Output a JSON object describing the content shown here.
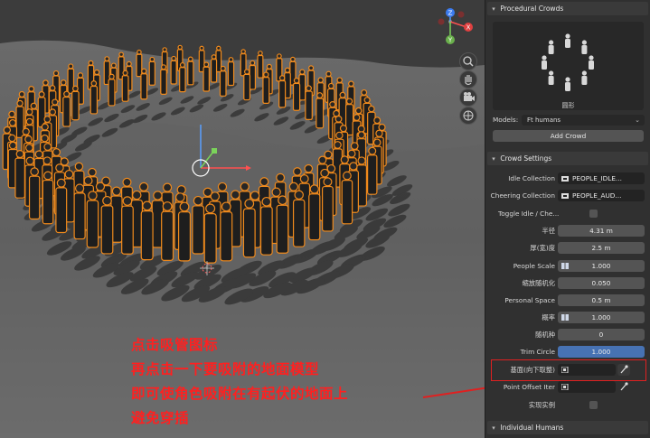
{
  "panel": {
    "procedural_crowds": {
      "title": "Procedural Crowds",
      "preview_label": "圆形",
      "models_label": "Models:",
      "models_value": "Ft humans",
      "add_button": "Add Crowd"
    },
    "crowd_settings": {
      "title": "Crowd Settings",
      "rows": [
        {
          "label": "Idle Collection",
          "value": "PEOPLE_IDLE..."
        },
        {
          "label": "Cheering Collection",
          "value": "PEOPLE_AUD..."
        },
        {
          "label": "Toggle Idle / Che..."
        },
        {
          "label": "半径",
          "value": "4.31 m"
        },
        {
          "label": "厚(宽)度",
          "value": "2.5 m"
        },
        {
          "label": "People Scale",
          "value": "1.000"
        },
        {
          "label": "缩放随机化",
          "value": "0.050"
        },
        {
          "label": "Personal Space",
          "value": "0.5 m"
        },
        {
          "label": "概率",
          "value": "1.000"
        },
        {
          "label": "随机种",
          "value": "0"
        },
        {
          "label": "Trim Circle",
          "value": "1.000"
        },
        {
          "label": "基面(向下取整)"
        },
        {
          "label": "Point Offset Iter"
        },
        {
          "label": "实现实例"
        }
      ]
    },
    "individual_humans": {
      "title": "Individual Humans"
    }
  },
  "annotation": {
    "lines": [
      "点击吸管图标",
      "再点击一下要吸附的地面模型",
      "即可使角色吸附在有起伏的地面上",
      "避免穿插"
    ],
    "color": "#ff2020"
  },
  "gizmo": {
    "x": "X",
    "y": "Y",
    "z": "Z"
  },
  "colors": {
    "selection_outline": "#f08a1c",
    "highlight_box": "#e02020",
    "accent_blue": "#4772b3"
  }
}
